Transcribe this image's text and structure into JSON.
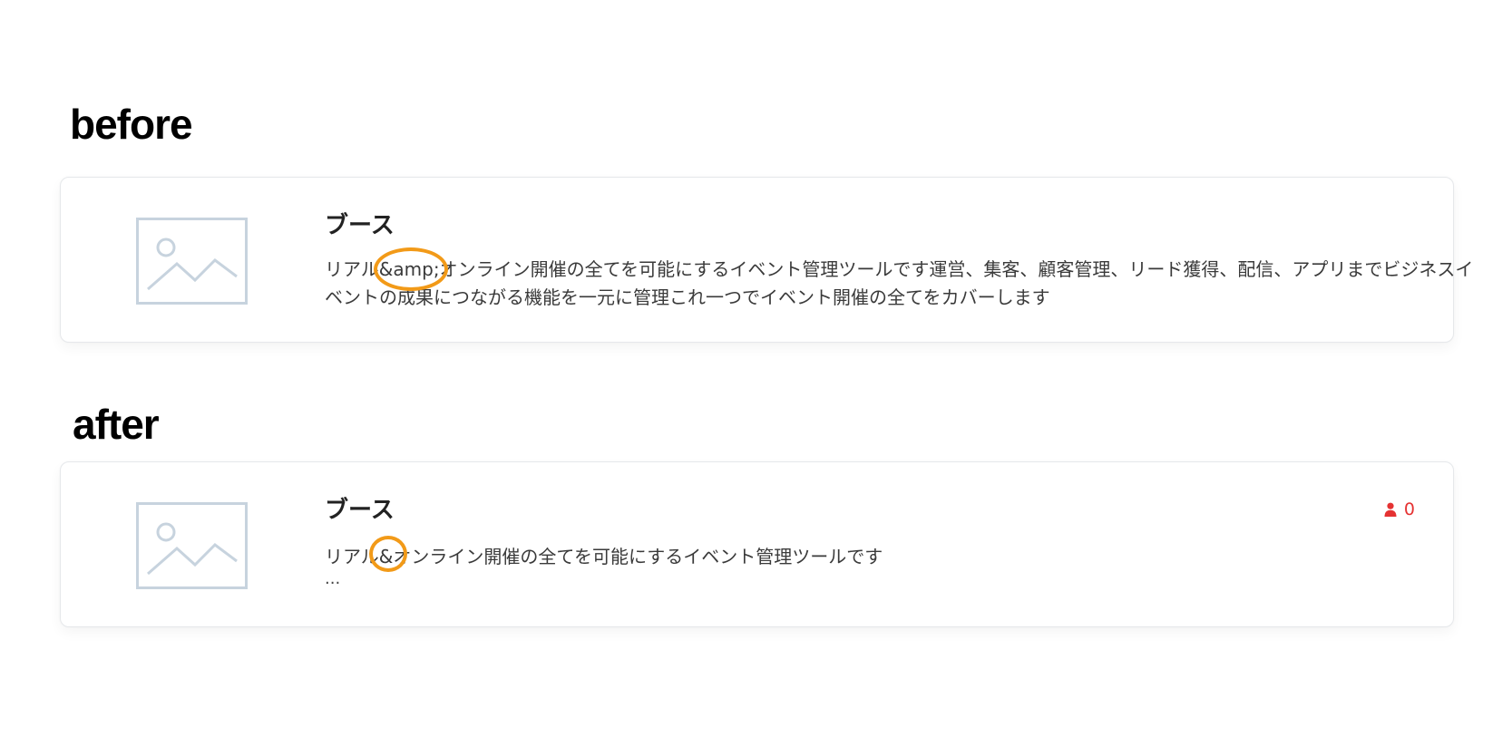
{
  "before": {
    "label": "before",
    "card": {
      "title": "ブース",
      "description": "リアル&amp;オンライン開催の全てを可能にするイベント管理ツールです運営、集客、顧客管理、リード獲得、配信、アプリまでビジネスイベントの成果につながる機能を一元に管理これ一つでイベント開催の全てをカバーします"
    }
  },
  "after": {
    "label": "after",
    "card": {
      "title": "ブース",
      "description": "リアル&オンライン開催の全てを可能にするイベント管理ツールです",
      "ellipsis": "...",
      "participant_count": "0"
    }
  },
  "icons": {
    "thumbnail": "image-placeholder-icon",
    "participants": "user-icon"
  },
  "colors": {
    "highlight": "#f29a18",
    "count": "#e53232",
    "placeholder": "#c7d3de"
  }
}
